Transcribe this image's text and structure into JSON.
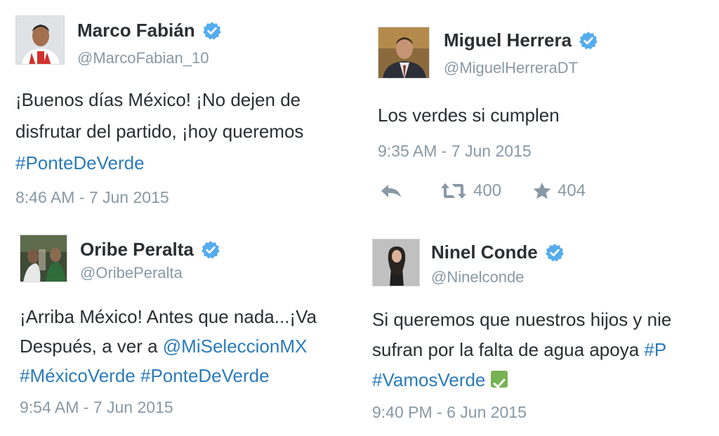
{
  "colors": {
    "link": "#2b7bb9",
    "muted": "#8899a6",
    "verified": "#55acee",
    "text": "#292f33"
  },
  "tweets": [
    {
      "name": "Marco Fabián",
      "handle": "@MarcoFabian_10",
      "lines": [
        "¡Buenos días México! ¡No dejen de",
        "disfrutar del partido, ¡hoy queremos"
      ],
      "hashtag_line": "#PonteDeVerde",
      "timestamp": "8:46 AM - 7 Jun 2015"
    },
    {
      "name": "Miguel Herrera",
      "handle": "@MiguelHerreraDT",
      "lines": [
        "Los verdes si cumplen"
      ],
      "timestamp": "9:35 AM - 7 Jun 2015",
      "retweets": "400",
      "favorites": "404"
    },
    {
      "name": "Oribe Peralta",
      "handle": "@OribePeralta",
      "line1": "¡Arriba México! Antes que nada...¡Va",
      "line2_prefix": "Después, a ver a ",
      "mention": "@MiSeleccionMX",
      "hashtag1": "#MéxicoVerde",
      "hashtag2": "#PonteDeVerde",
      "timestamp": "9:54 AM - 7 Jun 2015"
    },
    {
      "name": "Ninel Conde",
      "handle": "@Ninelconde",
      "line1": "Si queremos que nuestros hijos y nie",
      "line2_prefix": "sufran por la falta de agua apoya ",
      "line2_tag": "#P",
      "hashtag": "#VamosVerde",
      "timestamp": "9:40 PM - 6 Jun 2015"
    }
  ]
}
